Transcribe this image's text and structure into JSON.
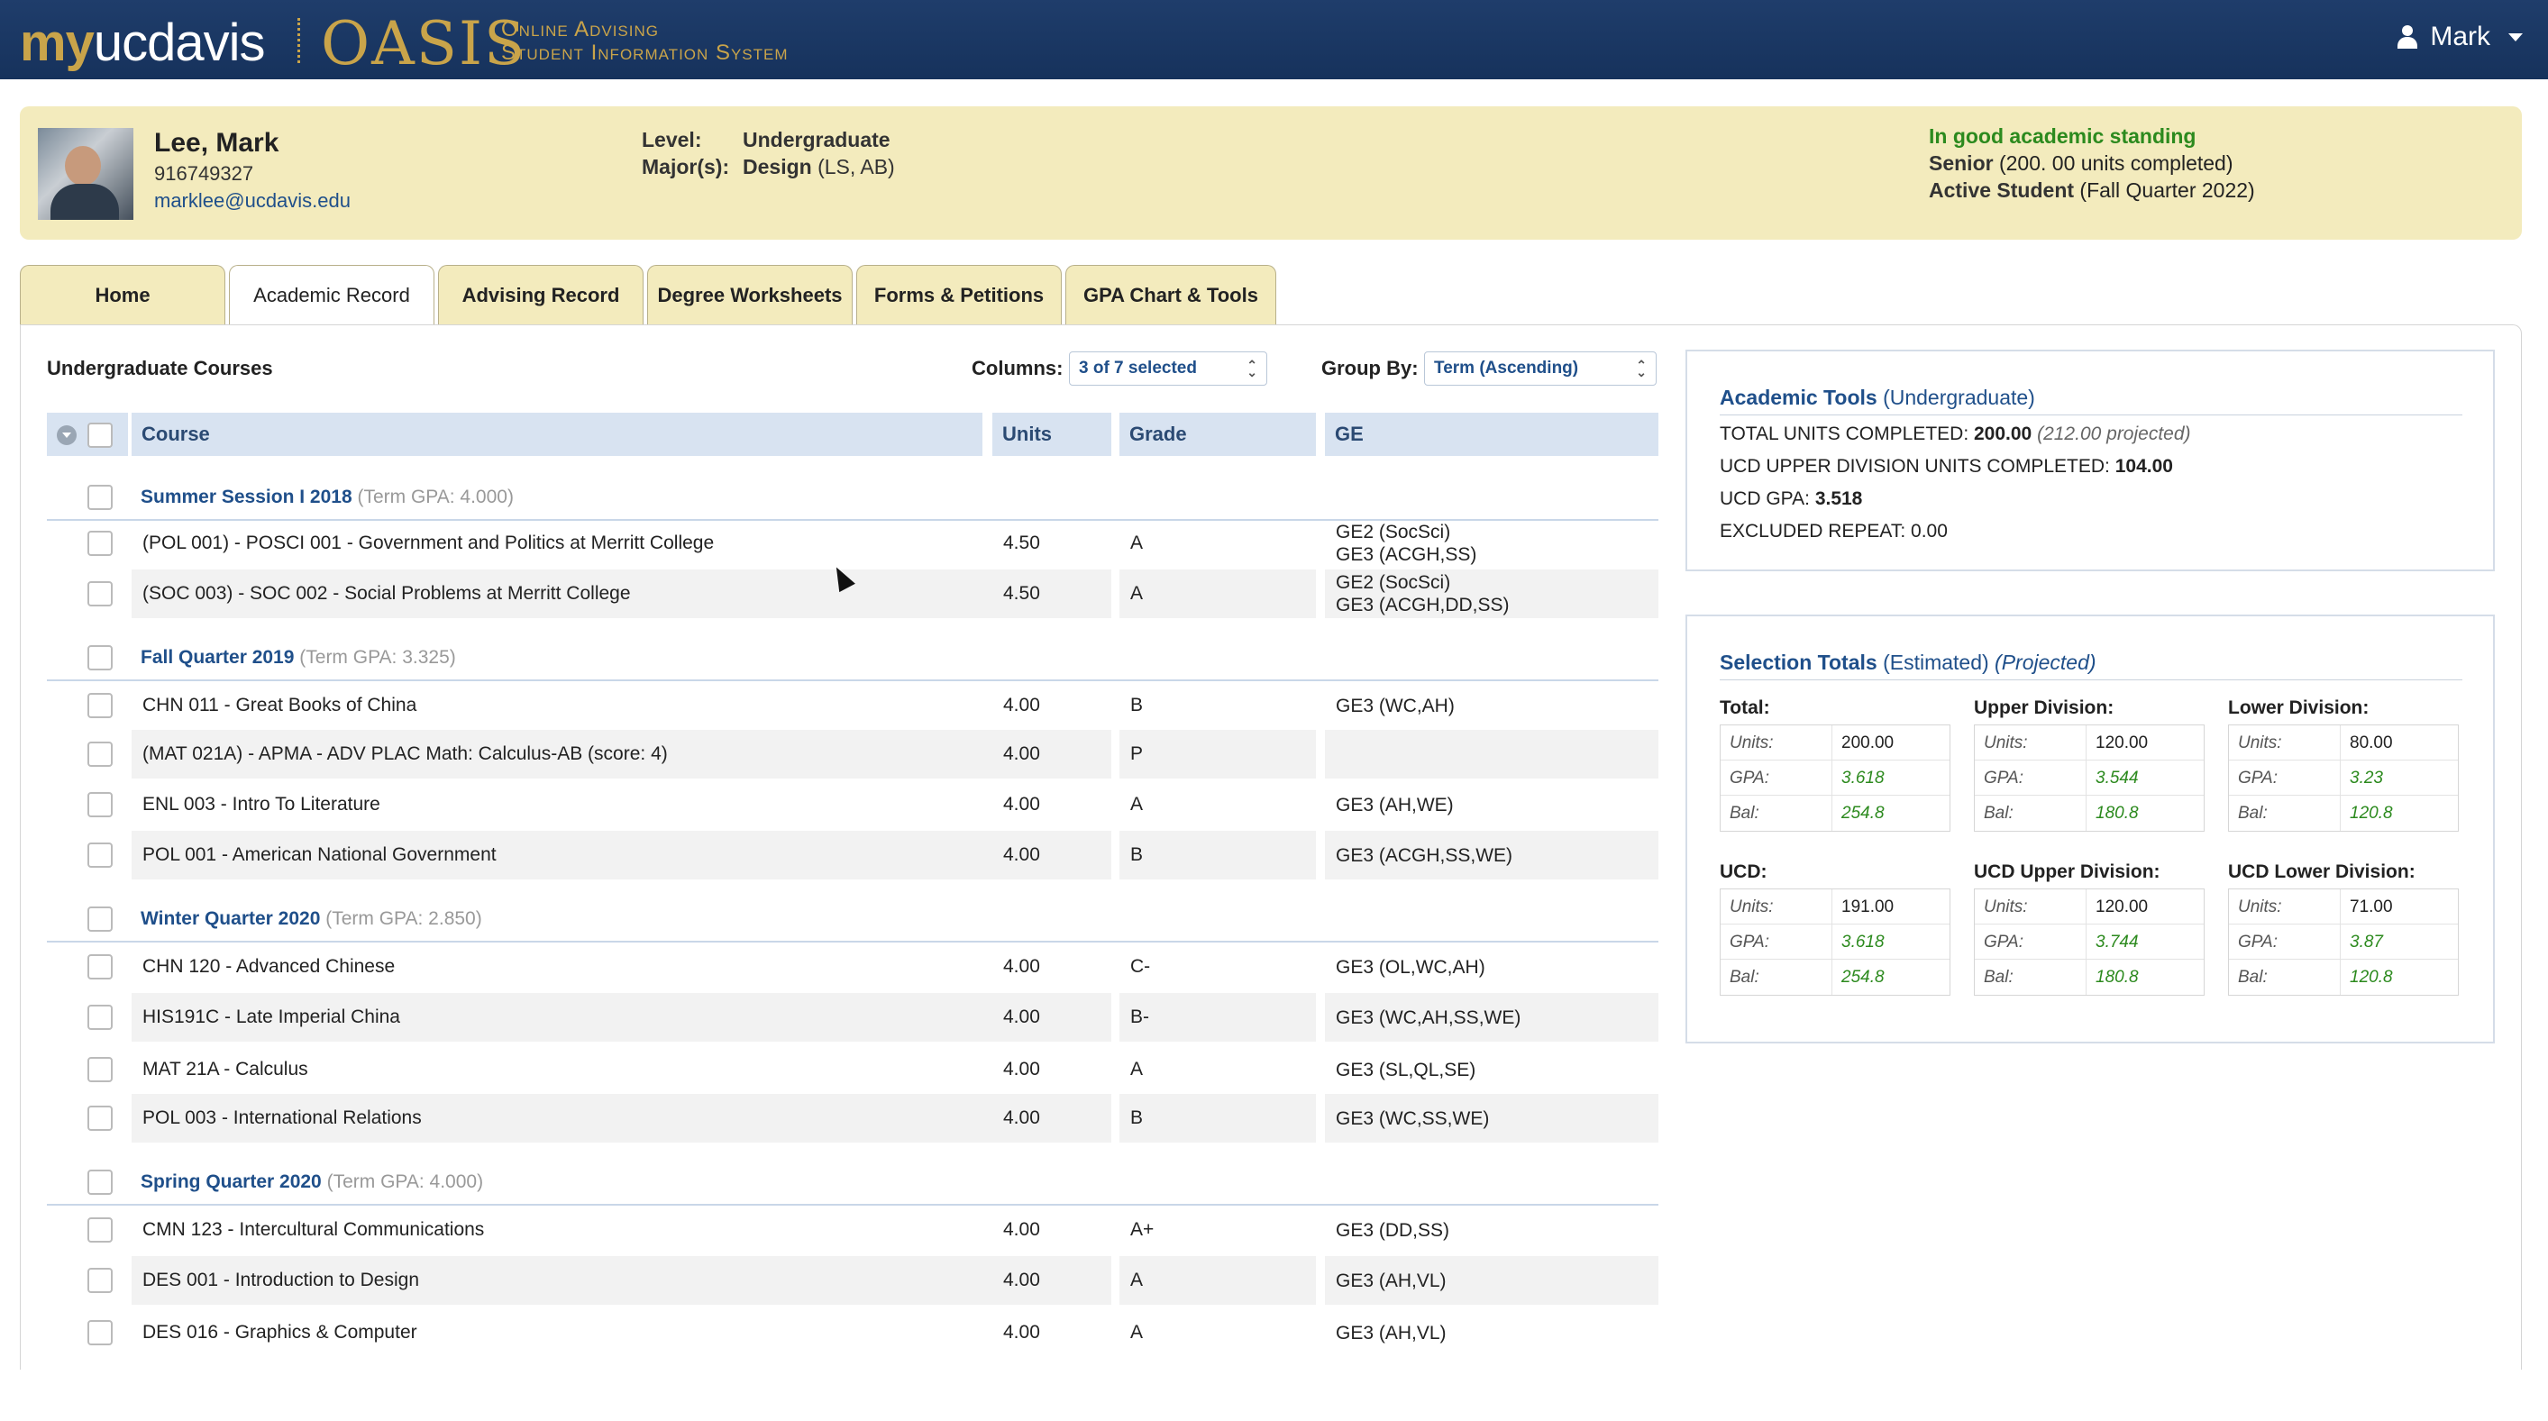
{
  "header": {
    "logo_my": "my",
    "logo_ucdavis": "ucdavis",
    "logo_oasis": "OASIS",
    "logo_sub_line1": "Online Advising",
    "logo_sub_line2": "Student Information System",
    "user_name": "Mark",
    "user_icon": "person-icon"
  },
  "student": {
    "name": "Lee, Mark",
    "id": "916749327",
    "email": "marklee@ucdavis.edu",
    "level_label": "Level:",
    "level_value": "Undergraduate",
    "major_label": "Major(s):",
    "major_value": "Design",
    "major_suffix": " (LS, AB)",
    "standing": "In good academic standing",
    "class_label": "Senior",
    "class_detail": " (200. 00 units completed)",
    "status_label": "Active Student",
    "status_detail": " (Fall Quarter 2022)",
    "colors": {
      "standing": "#2c8a1e",
      "banner": "#f3ebbd"
    }
  },
  "tabs": [
    {
      "label": "Home"
    },
    {
      "label": "Academic Record"
    },
    {
      "label": "Advising Record"
    },
    {
      "label": "Degree Worksheets"
    },
    {
      "label": "Forms & Petitions"
    },
    {
      "label": "GPA Chart & Tools"
    }
  ],
  "courses": {
    "title": "Undergraduate Courses",
    "columns_label": "Columns:",
    "columns_value": "3 of 7 selected",
    "groupby_label": "Group By:",
    "groupby_value": "Term (Ascending)",
    "headers": {
      "course": "Course",
      "units": "Units",
      "grade": "Grade",
      "ge": "GE"
    },
    "terms": [
      {
        "name": "Summer Session I 2018",
        "gpa": "(Term GPA: 4.000)",
        "rows": [
          {
            "course": "(POL 001) - POSCI 001 - Government and Politics at Merritt College",
            "units": "4.50",
            "grade": "A",
            "ge1": "GE2 (SocSci)",
            "ge2": "GE3 (ACGH,SS)"
          },
          {
            "course": "(SOC 003) - SOC 002 - Social Problems at Merritt College",
            "units": "4.50",
            "grade": "A",
            "ge1": "GE2 (SocSci)",
            "ge2": "GE3 (ACGH,DD,SS)"
          }
        ]
      },
      {
        "name": "Fall Quarter 2019",
        "gpa": "(Term GPA: 3.325)",
        "rows": [
          {
            "course": "CHN 011 - Great Books of China",
            "units": "4.00",
            "grade": "B",
            "ge1": "GE3 (WC,AH)",
            "ge2": ""
          },
          {
            "course": "(MAT 021A) - APMA - ADV PLAC Math: Calculus-AB (score: 4)",
            "units": "4.00",
            "grade": "P",
            "ge1": "",
            "ge2": ""
          },
          {
            "course": "ENL 003 - Intro To Literature",
            "units": "4.00",
            "grade": "A",
            "ge1": "GE3 (AH,WE)",
            "ge2": ""
          },
          {
            "course": "POL 001 - American National Government",
            "units": "4.00",
            "grade": "B",
            "ge1": "GE3 (ACGH,SS,WE)",
            "ge2": ""
          }
        ]
      },
      {
        "name": "Winter Quarter 2020",
        "gpa": "(Term GPA: 2.850)",
        "rows": [
          {
            "course": "CHN 120 - Advanced Chinese",
            "units": "4.00",
            "grade": "C-",
            "ge1": "GE3 (OL,WC,AH)",
            "ge2": ""
          },
          {
            "course": "HIS191C - Late Imperial China",
            "units": "4.00",
            "grade": "B-",
            "ge1": "GE3 (WC,AH,SS,WE)",
            "ge2": ""
          },
          {
            "course": "MAT 21A - Calculus",
            "units": "4.00",
            "grade": "A",
            "ge1": "GE3 (SL,QL,SE)",
            "ge2": ""
          },
          {
            "course": "POL 003 - International Relations",
            "units": "4.00",
            "grade": "B",
            "ge1": "GE3 (WC,SS,WE)",
            "ge2": ""
          }
        ]
      },
      {
        "name": "Spring Quarter 2020",
        "gpa": "(Term GPA: 4.000)",
        "rows": [
          {
            "course": "CMN 123 - Intercultural Communications",
            "units": "4.00",
            "grade": "A+",
            "ge1": "GE3 (DD,SS)",
            "ge2": ""
          },
          {
            "course": "DES 001 - Introduction to Design",
            "units": "4.00",
            "grade": "A",
            "ge1": "GE3 (AH,VL)",
            "ge2": ""
          },
          {
            "course": "DES 016 - Graphics & Computer",
            "units": "4.00",
            "grade": "A",
            "ge1": "GE3 (AH,VL)",
            "ge2": ""
          }
        ]
      }
    ]
  },
  "tools": {
    "title": "Academic Tools",
    "title_suffix": "(Undergraduate)",
    "total_label": "TOTAL UNITS COMPLETED:",
    "total_value": "200.00",
    "total_projected": "(212.00 projected)",
    "upper_label": "UCD UPPER DIVISION UNITS COMPLETED:",
    "upper_value": "104.00",
    "gpa_label": "UCD GPA:",
    "gpa_value": "3.518",
    "excluded_label": "EXCLUDED REPEAT:",
    "excluded_value": "0.00"
  },
  "selection": {
    "title": "Selection Totals",
    "title_estimated": "(Estimated)",
    "title_projected": "(Projected)",
    "keys": {
      "units": "Units:",
      "gpa": "GPA:",
      "bal": "Bal:"
    },
    "groups": [
      {
        "label": "Total:",
        "units": "200.00",
        "gpa": "3.618",
        "bal": "254.8"
      },
      {
        "label": "Upper Division:",
        "units": "120.00",
        "gpa": "3.544",
        "bal": "180.8"
      },
      {
        "label": "Lower Division:",
        "units": "80.00",
        "gpa": "3.23",
        "bal": "120.8"
      },
      {
        "label": "UCD:",
        "units": "191.00",
        "gpa": "3.618",
        "bal": "254.8"
      },
      {
        "label": "UCD Upper Division:",
        "units": "120.00",
        "gpa": "3.744",
        "bal": "180.8"
      },
      {
        "label": "UCD Lower Division:",
        "units": "71.00",
        "gpa": "3.87",
        "bal": "120.8"
      }
    ]
  }
}
